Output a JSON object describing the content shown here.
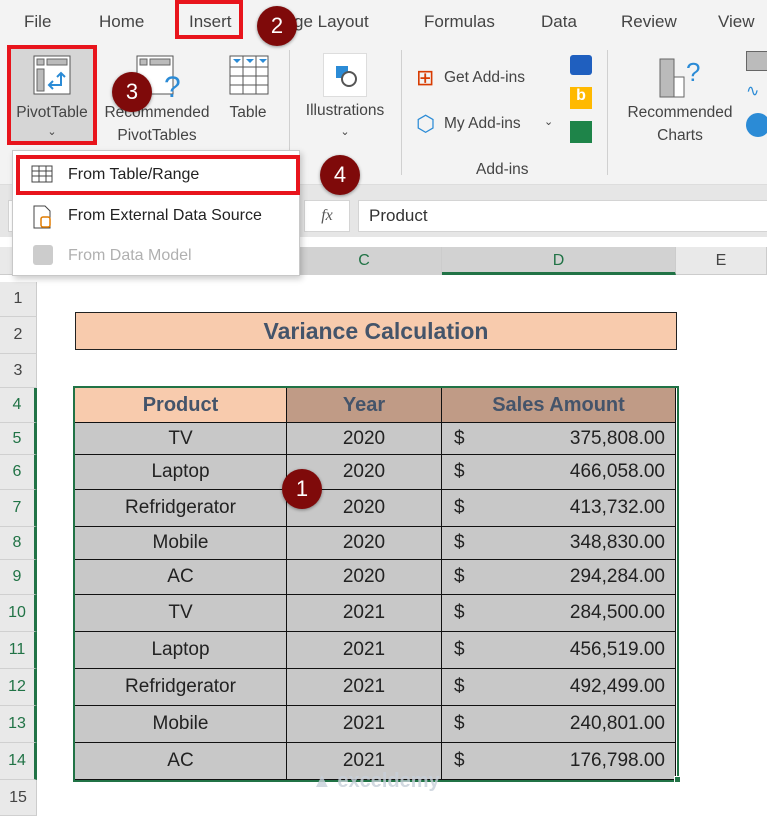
{
  "tabs": [
    "File",
    "Home",
    "Insert",
    "ge Layout",
    "Formulas",
    "Data",
    "Review",
    "View"
  ],
  "ribbon": {
    "pivot_table": "PivotTable",
    "recommended_pivot_1": "Recommended",
    "recommended_pivot_2": "PivotTables",
    "table": "Table",
    "illustrations": "Illustrations",
    "get_addins": "Get Add-ins",
    "my_addins": "My Add-ins",
    "addins_group": "Add-ins",
    "rec_charts_1": "Recommended",
    "rec_charts_2": "Charts"
  },
  "pivot_menu": {
    "items": [
      {
        "label": "From Table/Range",
        "icon": "table-icon",
        "enabled": true
      },
      {
        "label": "From External Data Source",
        "icon": "external-data-icon",
        "enabled": true
      },
      {
        "label": "From Data Model",
        "icon": "data-model-icon",
        "enabled": false
      }
    ]
  },
  "formula_bar": {
    "fx": "fx",
    "value": "Product"
  },
  "columns": [
    "C",
    "D",
    "E"
  ],
  "rows": [
    "1",
    "2",
    "3",
    "4",
    "5",
    "6",
    "7",
    "8",
    "9",
    "10",
    "11",
    "12",
    "13",
    "14",
    "15"
  ],
  "sheet": {
    "title": "Variance Calculation",
    "headers": [
      "Product",
      "Year",
      "Sales Amount"
    ],
    "currency": "$",
    "data": [
      [
        "TV",
        "2020",
        "375,808.00"
      ],
      [
        "Laptop",
        "2020",
        "466,058.00"
      ],
      [
        "Refridgerator",
        "2020",
        "413,732.00"
      ],
      [
        "Mobile",
        "2020",
        "348,830.00"
      ],
      [
        "AC",
        "2020",
        "294,284.00"
      ],
      [
        "TV",
        "2021",
        "284,500.00"
      ],
      [
        "Laptop",
        "2021",
        "456,519.00"
      ],
      [
        "Refridgerator",
        "2021",
        "492,499.00"
      ],
      [
        "Mobile",
        "2021",
        "240,801.00"
      ],
      [
        "AC",
        "2021",
        "176,798.00"
      ]
    ]
  },
  "steps": [
    "1",
    "2",
    "3",
    "4"
  ],
  "watermark": "exceldemy",
  "colors": {
    "accent_green": "#217346",
    "highlight_red": "#e8141c",
    "badge": "#7f0a0a",
    "title_fill": "#f8cbad",
    "header_year_fill": "#c09b86",
    "cell_fill": "#c8c8c8"
  }
}
